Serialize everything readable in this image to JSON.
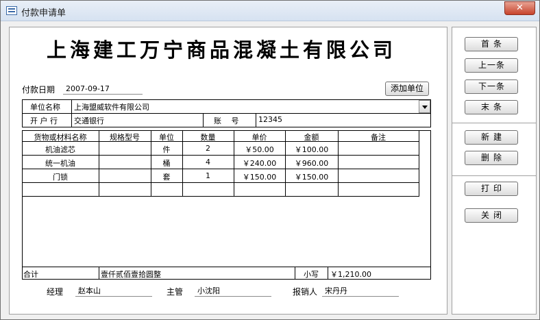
{
  "window": {
    "title": "付款申请单",
    "close_label": "✕"
  },
  "header": {
    "company": "上海建工万宁商品混凝土有限公司"
  },
  "payment_date": {
    "label": "付款日期",
    "value": "2007-09-17"
  },
  "add_unit_label": "添加单位",
  "unit": {
    "name_label": "单位名称",
    "name_value": "上海盟威软件有限公司"
  },
  "bank": {
    "label": "开 户 行",
    "value": "交通银行",
    "account_label": "账　 号",
    "account_value": "12345"
  },
  "table": {
    "headers": [
      "货物或材料名称",
      "规格型号",
      "单位",
      "数量",
      "单价",
      "金额",
      "备注"
    ],
    "rows": [
      {
        "name": "机油滤芯",
        "spec": "",
        "unit": "件",
        "qty": "2",
        "price": "￥50.00",
        "amount": "￥100.00",
        "note": ""
      },
      {
        "name": "统一机油",
        "spec": "",
        "unit": "桶",
        "qty": "4",
        "price": "￥240.00",
        "amount": "￥960.00",
        "note": ""
      },
      {
        "name": "门锁",
        "spec": "",
        "unit": "套",
        "qty": "1",
        "price": "￥150.00",
        "amount": "￥150.00",
        "note": ""
      }
    ]
  },
  "total": {
    "label": "合计",
    "words": "壹仟贰佰壹拾圆整",
    "small_label": "小写",
    "small_value": "￥1,210.00"
  },
  "signatures": {
    "manager_label": "经理",
    "manager_value": "赵本山",
    "supervisor_label": "主管",
    "supervisor_value": "小沈阳",
    "applicant_label": "报销人",
    "applicant_value": "宋丹丹"
  },
  "side_buttons": {
    "first": "首条",
    "prev": "上一条",
    "next": "下一条",
    "last": "末条",
    "new": "新建",
    "delete": "删除",
    "print": "打印",
    "close": "关闭"
  },
  "colors": {
    "title_bar": "#dbe6f4",
    "close_button": "#c7432b"
  }
}
